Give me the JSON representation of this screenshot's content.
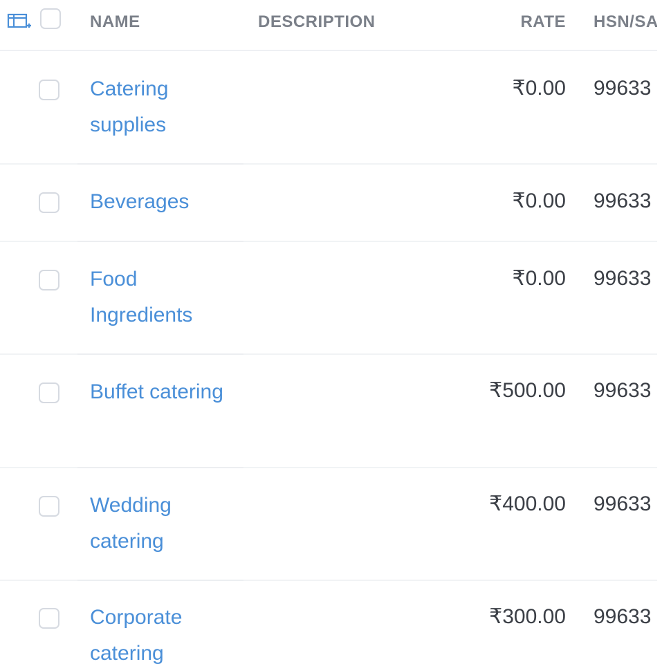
{
  "table": {
    "columns": {
      "name": "NAME",
      "description": "DESCRIPTION",
      "rate": "RATE",
      "hsn": "HSN/SA"
    },
    "rows": [
      {
        "name": "Catering supplies",
        "description": "",
        "rate": "₹0.00",
        "hsn": "99633"
      },
      {
        "name": "Beverages",
        "description": "",
        "rate": "₹0.00",
        "hsn": "99633"
      },
      {
        "name": "Food Ingredients",
        "description": "",
        "rate": "₹0.00",
        "hsn": "99633"
      },
      {
        "name": "Buffet catering",
        "description": "",
        "rate": "₹500.00",
        "hsn": "99633"
      },
      {
        "name": "Wedding catering",
        "description": "",
        "rate": "₹400.00",
        "hsn": "99633"
      },
      {
        "name": "Corporate catering",
        "description": "",
        "rate": "₹300.00",
        "hsn": "99633"
      }
    ]
  },
  "colors": {
    "link": "#4a8fd8",
    "header_text": "#7b8089",
    "body_text": "#3b3f46",
    "border": "#eef0f3"
  },
  "icons": {
    "column_settings": "column-settings-icon"
  }
}
